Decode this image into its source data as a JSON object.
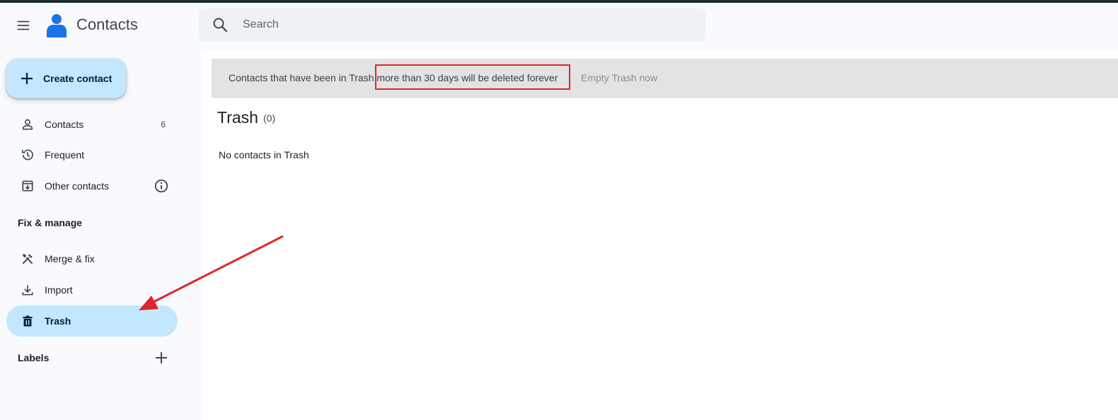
{
  "header": {
    "app_title": "Contacts",
    "search_placeholder": "Search",
    "menu_icon": "menu-icon",
    "logo_icon": "contacts-logo-icon"
  },
  "sidebar": {
    "create_label": "Create contact",
    "items": [
      {
        "label": "Contacts",
        "count": "6",
        "icon": "person-icon"
      },
      {
        "label": "Frequent",
        "icon": "history-icon"
      },
      {
        "label": "Other contacts",
        "icon": "archive-download-icon"
      }
    ],
    "fix_manage_heading": "Fix & manage",
    "manage_items": [
      {
        "label": "Merge & fix",
        "icon": "tools-icon"
      },
      {
        "label": "Import",
        "icon": "download-icon"
      },
      {
        "label": "Trash",
        "icon": "trash-icon",
        "active": true
      }
    ],
    "labels_heading": "Labels"
  },
  "main": {
    "banner_text": "Contacts that have been in Trash more than 30 days will be deleted forever",
    "banner_action": "Empty Trash now",
    "title": "Trash",
    "count": "(0)",
    "empty_message": "No contacts in Trash"
  },
  "colors": {
    "accent": "#c2e7ff",
    "annotation": "#e0262b",
    "banner_bg": "#e3e3e3"
  }
}
